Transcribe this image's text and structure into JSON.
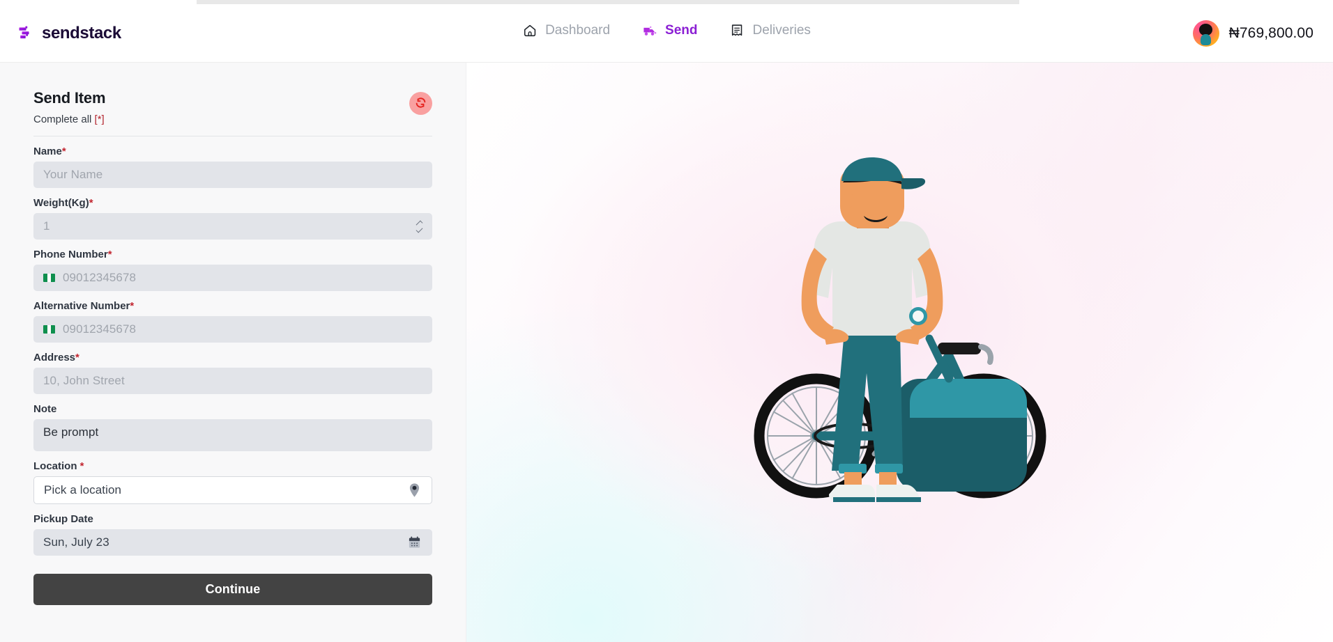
{
  "brand": {
    "name": "sendstack",
    "logo_icon": "sendstack-logo-icon"
  },
  "nav": {
    "items": [
      {
        "label": "Dashboard",
        "icon": "home-icon",
        "active": false
      },
      {
        "label": "Send",
        "icon": "delivery-truck-icon",
        "active": true
      },
      {
        "label": "Deliveries",
        "icon": "receipt-icon",
        "active": false
      }
    ],
    "active_color": "#8B1FD4",
    "inactive_color": "#9DA3AC"
  },
  "account": {
    "avatar_icon": "user-avatar",
    "balance": "₦769,800.00"
  },
  "form": {
    "title": "Send Item",
    "subtitle_text": "Complete all ",
    "subtitle_required": "[*]",
    "reset_icon": "refresh-icon",
    "fields": [
      {
        "label": "Name",
        "required": true,
        "placeholder": "Your Name",
        "value": "",
        "type": "text"
      },
      {
        "label": "Weight(Kg)",
        "required": true,
        "placeholder": "1",
        "value": "1",
        "type": "number",
        "icon": "number-spinner-icon"
      },
      {
        "label": "Phone Number",
        "required": true,
        "placeholder": "09012345678",
        "value": "",
        "type": "tel",
        "icon": "nigeria-flag-icon"
      },
      {
        "label": "Alternative Number",
        "required": true,
        "placeholder": "09012345678",
        "value": "",
        "type": "tel",
        "icon": "nigeria-flag-icon"
      },
      {
        "label": "Address",
        "required": true,
        "placeholder": "10, John Street",
        "value": "",
        "type": "text"
      },
      {
        "label": "Note",
        "required": false,
        "placeholder": "Be prompt",
        "value": "Be prompt",
        "type": "textarea"
      },
      {
        "label": "Location ",
        "required": true,
        "placeholder": "Pick a location",
        "value": "Pick a location",
        "type": "select",
        "icon": "map-pin-icon"
      },
      {
        "label": "Pickup Date",
        "required": false,
        "placeholder": "Sun, July 23",
        "value": "Sun, July 23",
        "type": "date",
        "icon": "calendar-icon"
      }
    ],
    "submit_label": "Continue",
    "required_marker": "*"
  },
  "illustration": {
    "name": "delivery-rider-with-bicycle",
    "colors": {
      "teal": "#21707c",
      "teal_dark": "#1b5d68",
      "teal_light": "#2f97a6",
      "skin": "#ef9d5d",
      "shirt": "#e4e7e4",
      "hair": "#1b1b1b",
      "tire": "#111111",
      "spoke": "#9aa3ab"
    }
  },
  "theme": {
    "panel_bg": "#f8f8f9",
    "input_bg": "#e2e4e9",
    "submit_bg": "#434343",
    "required_red": "#c22630",
    "reset_bg": "#f9a0a0",
    "reset_fg": "#e02020"
  }
}
